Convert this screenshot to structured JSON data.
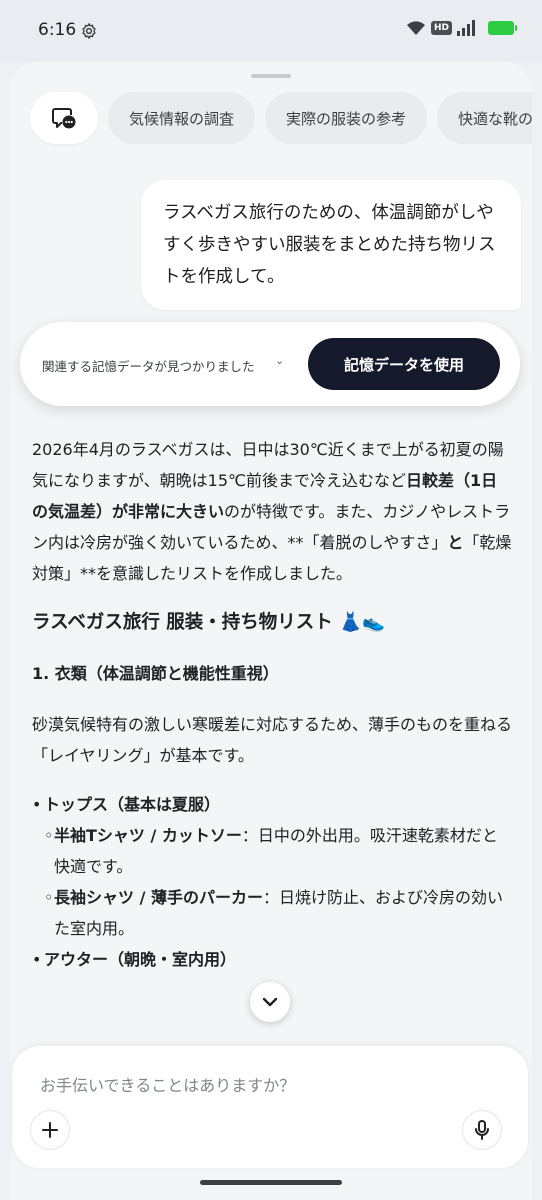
{
  "status_bar": {
    "time": "6:16",
    "hd_label": "HD",
    "battery_color": "#2ecc40"
  },
  "chips": [
    "気候情報の調査",
    "実際の服装の参考",
    "快適な靴の"
  ],
  "user_message": "ラスベガス旅行のための、体温調節がしやすく歩きやすい服装をまとめた持ち物リストを作成して。",
  "memory": {
    "text": "関連する記憶データが見つかりました",
    "button_label": "記憶データを使用"
  },
  "response": {
    "intro_1": "2026年4月のラスベガスは、日中は30℃近くまで上がる初夏の陽気になりますが、朝晩は15℃前後まで冷え込むなど",
    "intro_bold": "日較差（1日の気温差）が非常に大きい",
    "intro_2": "のが特徴です。また、カジノやレストラン内は冷房が強く効いているため、**「着脱のしやすさ」",
    "intro_and": "と",
    "intro_3": "「乾燥対策」**を意識したリストを作成しました。",
    "heading": "ラスベガス旅行 服装・持ち物リスト 👗👟",
    "section_1_title": "1. 衣類（体温調節と機能性重視）",
    "section_1_body": "砂漠気候特有の激しい寒暖差に対応するため、薄手のものを重ねる「レイヤリング」が基本です。",
    "bullet_tops": "トップス（基本は夏服）",
    "sub_1_bold": "半袖Tシャツ / カットソー",
    "sub_1_text": "：日中の外出用。吸汗速乾素材だと快適です。",
    "sub_2_bold": "長袖シャツ / 薄手のパーカー",
    "sub_2_text": "：日焼け防止、および冷房の効いた室内用。",
    "bullet_outer": "アウター（朝晩・室内用）"
  },
  "composer": {
    "placeholder": "お手伝いできることはありますか？"
  }
}
